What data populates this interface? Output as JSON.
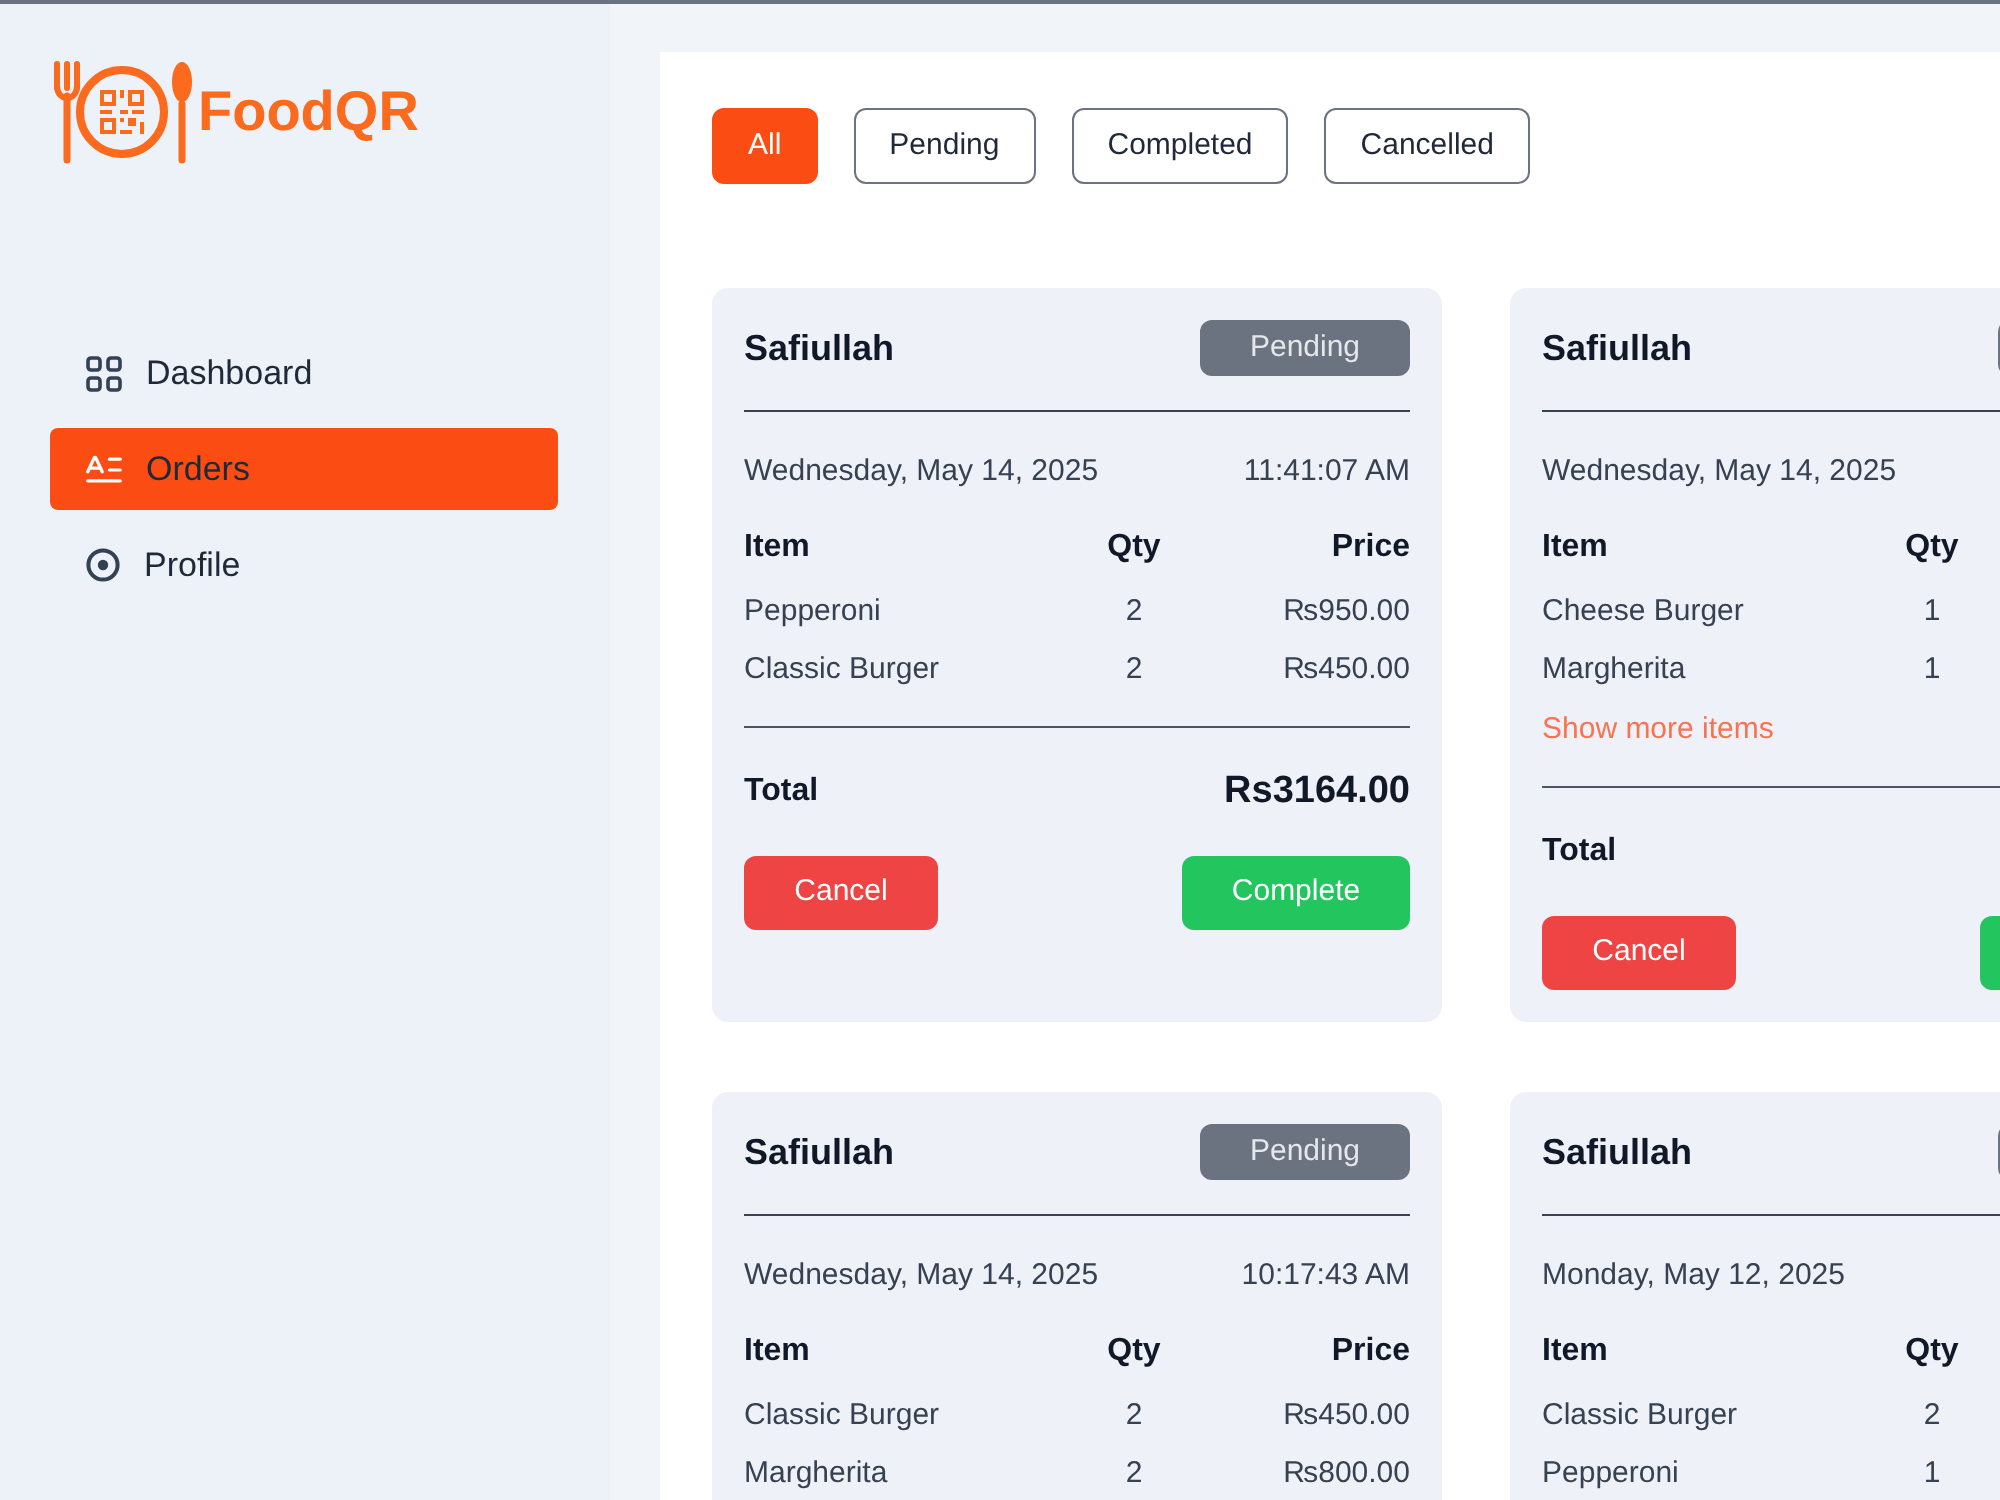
{
  "sidebar": {
    "logo_text": "FoodQR",
    "items": [
      {
        "label": "Dashboard",
        "selected": false
      },
      {
        "label": "Orders",
        "selected": true
      },
      {
        "label": "Profile",
        "selected": false
      }
    ]
  },
  "filters": [
    {
      "label": "All",
      "selected": true
    },
    {
      "label": "Pending",
      "selected": false
    },
    {
      "label": "Completed",
      "selected": false
    },
    {
      "label": "Cancelled",
      "selected": false
    }
  ],
  "orders": [
    {
      "customer": "Safiullah",
      "status": {
        "kind": "pending",
        "label": "Pending"
      },
      "date": "Wednesday, May 14, 2025",
      "time": "11:41:07 AM",
      "columns": [
        "Item",
        "Qty",
        "Price"
      ],
      "items": [
        {
          "name": "Pepperoni",
          "qty": "2",
          "price": "₨950.00"
        },
        {
          "name": "Classic Burger",
          "qty": "2",
          "price": "₨450.00"
        }
      ],
      "total_label": "Total",
      "total": "Rs3164.00",
      "actions": [
        {
          "kind": "cancel",
          "label": "Cancel"
        },
        {
          "kind": "complete",
          "label": "Complete"
        }
      ]
    },
    {
      "customer": "Safiullah",
      "status": {
        "kind": "pending"
      },
      "date": "Wednesday, May 14, 2025",
      "columns": [
        "Item",
        "Qty"
      ],
      "items": [
        {
          "name": "Cheese Burger",
          "qty": "1"
        },
        {
          "name": "Margherita",
          "qty": "1"
        }
      ],
      "show_more": "Show more items",
      "total_label": "Total",
      "actions": [
        {
          "kind": "cancel",
          "label": "Cancel"
        },
        {
          "kind": "complete"
        }
      ]
    },
    {
      "customer": "Safiullah",
      "status": {
        "kind": "pending",
        "label": "Pending"
      },
      "date": "Wednesday, May 14, 2025",
      "time": "10:17:43 AM",
      "columns": [
        "Item",
        "Qty",
        "Price"
      ],
      "items": [
        {
          "name": "Classic Burger",
          "qty": "2",
          "price": "₨450.00"
        },
        {
          "name": "Margherita",
          "qty": "2",
          "price": "₨800.00"
        }
      ]
    },
    {
      "customer": "Safiullah",
      "status": {
        "kind": "pending"
      },
      "date": "Monday, May 12, 2025",
      "columns": [
        "Item",
        "Qty"
      ],
      "items": [
        {
          "name": "Classic Burger",
          "qty": "2"
        },
        {
          "name": "Pepperoni",
          "qty": "1"
        }
      ]
    }
  ]
}
